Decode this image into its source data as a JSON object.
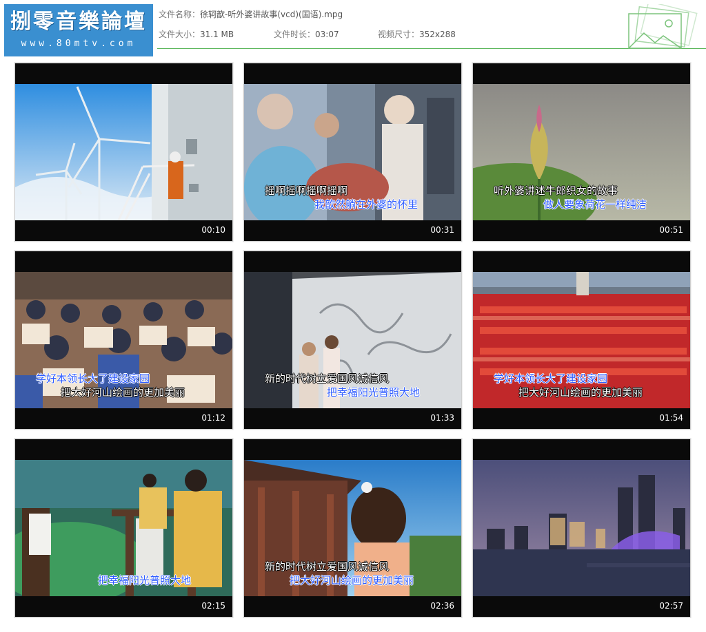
{
  "logo": {
    "title": "捌零音樂論壇",
    "url": "www.80mtv.com"
  },
  "file": {
    "name_label": "文件名称：",
    "name": "徐轲歆-听外婆讲故事(vcd)(国语).mpg",
    "size_label": "文件大小：",
    "size": "31.1 MB",
    "duration_label": "文件时长：",
    "duration": "03:07",
    "dimensions_label": "视频尺寸：",
    "dimensions": "352x288"
  },
  "thumbnails": [
    {
      "time": "00:10",
      "scene": "wind-turbines",
      "subs": []
    },
    {
      "time": "00:31",
      "scene": "family-gathering",
      "subs": [
        "摇啊摇啊摇啊摇啊",
        "我歆然躺在外婆的怀里"
      ]
    },
    {
      "time": "00:51",
      "scene": "lotus-bud",
      "subs": [
        "听外婆讲述牛郎织女的故事",
        "做人要象荷花一样纯洁"
      ]
    },
    {
      "time": "01:12",
      "scene": "classroom",
      "subs": [
        "学好本领长大了建设家园",
        "把大好河山绘画的更加美丽"
      ]
    },
    {
      "time": "01:33",
      "scene": "relief-wall",
      "subs": [
        "新的时代树立爱国风诚信风",
        "把幸福阳光普照大地"
      ]
    },
    {
      "time": "01:54",
      "scene": "red-flags-square",
      "subs": [
        "学好本领长大了建设家园",
        "把大好河山绘画的更加美丽"
      ]
    },
    {
      "time": "02:15",
      "scene": "girls-painting",
      "subs": [
        "把幸福阳光普照大地"
      ]
    },
    {
      "time": "02:36",
      "scene": "girl-pavilion",
      "subs": [
        "新的时代树立爱国风诚信风",
        "把大好河山绘画的更加美丽"
      ]
    },
    {
      "time": "02:57",
      "scene": "city-night",
      "subs": []
    }
  ]
}
